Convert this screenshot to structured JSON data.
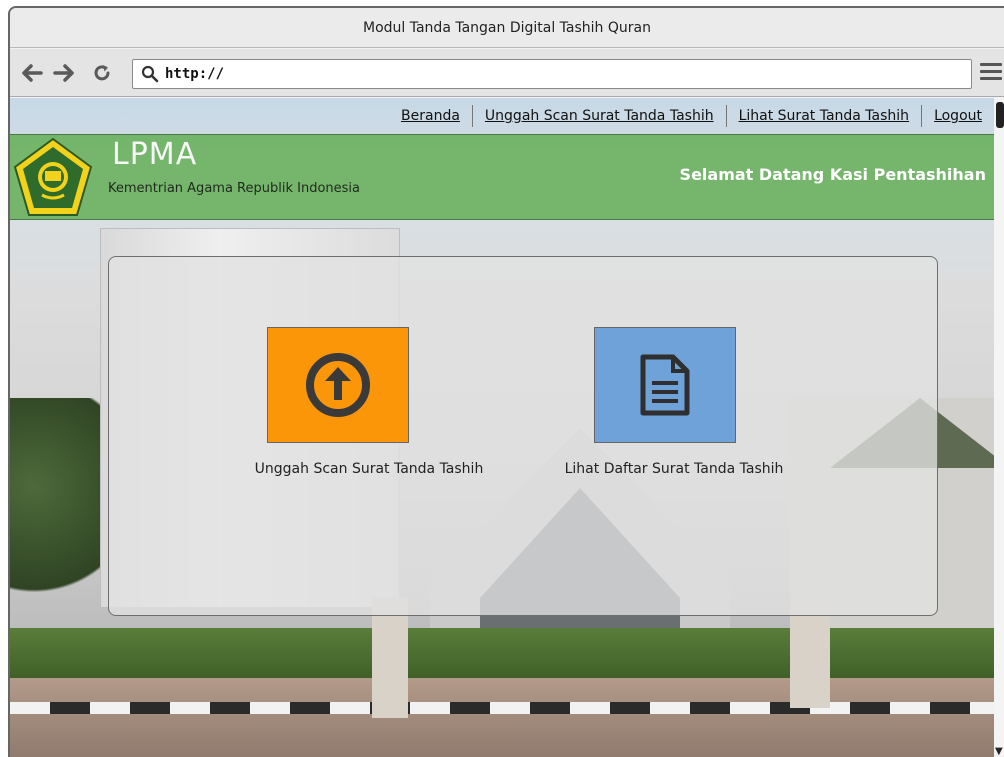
{
  "window": {
    "title": "Modul Tanda Tangan Digital Tashih Quran"
  },
  "browser": {
    "back_icon": "arrow-left-icon",
    "forward_icon": "arrow-right-icon",
    "reload_icon": "reload-icon",
    "search_icon": "search-icon",
    "url": "http://",
    "menu_icon": "hamburger-menu-icon"
  },
  "nav": {
    "items": [
      {
        "label": "Beranda"
      },
      {
        "label": "Unggah Scan Surat Tanda Tashih"
      },
      {
        "label": "Lihat Surat Tanda Tashih"
      },
      {
        "label": "Logout"
      }
    ]
  },
  "header": {
    "title": "LPMA",
    "subtitle": "Kementrian Agama Republik Indonesia",
    "welcome": "Selamat Datang Kasi Pentashihan",
    "bg_color": "#6fb264",
    "logo_icon": "kemenag-emblem-icon"
  },
  "actions": [
    {
      "label": "Unggah Scan Surat Tanda Tashih",
      "icon": "upload-arrow-icon",
      "color": "#fb9608"
    },
    {
      "label": "Lihat Daftar Surat Tanda Tashih",
      "icon": "document-icon",
      "color": "#6ea2d8"
    }
  ]
}
